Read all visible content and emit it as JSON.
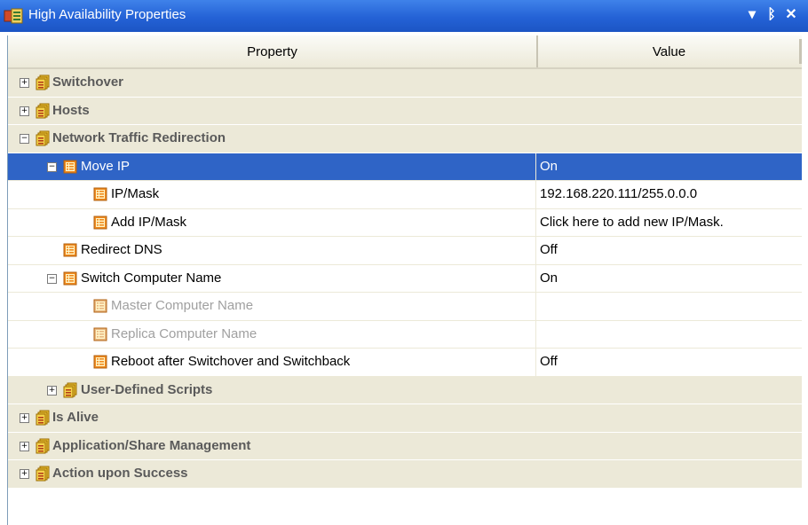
{
  "window": {
    "title": "High Availability Properties",
    "colors": {
      "titlebar": "#2462d6",
      "selection": "#2f64c6",
      "category_bg": "#ece9d8"
    }
  },
  "buttons": {
    "dropdown": "▾",
    "pin": "ᛒ",
    "close": "✕"
  },
  "header": {
    "property": "Property",
    "value": "Value"
  },
  "rows": [
    {
      "kind": "category",
      "label": "Switchover",
      "value": "",
      "expander": "+"
    },
    {
      "kind": "category",
      "label": "Hosts",
      "value": "",
      "expander": "+"
    },
    {
      "kind": "category",
      "label": "Network Traffic Redirection",
      "value": "",
      "expander": "−"
    },
    {
      "kind": "property",
      "label": "Move IP",
      "value": "On",
      "expander": "−",
      "selected": true
    },
    {
      "kind": "property",
      "label": "IP/Mask",
      "value": "192.168.220.111/255.0.0.0"
    },
    {
      "kind": "property",
      "label": "Add IP/Mask",
      "value": "Click here to add new IP/Mask."
    },
    {
      "kind": "property",
      "label": "Redirect DNS",
      "value": "Off"
    },
    {
      "kind": "property",
      "label": "Switch Computer Name",
      "value": "On",
      "expander": "−"
    },
    {
      "kind": "property",
      "label": "Master Computer Name",
      "value": "",
      "disabled": true
    },
    {
      "kind": "property",
      "label": "Replica Computer Name",
      "value": "",
      "disabled": true
    },
    {
      "kind": "property",
      "label": "Reboot after Switchover and Switchback",
      "value": "Off"
    },
    {
      "kind": "category",
      "label": "User-Defined Scripts",
      "value": "",
      "expander": "+"
    },
    {
      "kind": "category",
      "label": "Is Alive",
      "value": "",
      "expander": "+"
    },
    {
      "kind": "category",
      "label": "Application/Share Management",
      "value": "",
      "expander": "+"
    },
    {
      "kind": "category",
      "label": "Action upon Success",
      "value": "",
      "expander": "+"
    }
  ]
}
